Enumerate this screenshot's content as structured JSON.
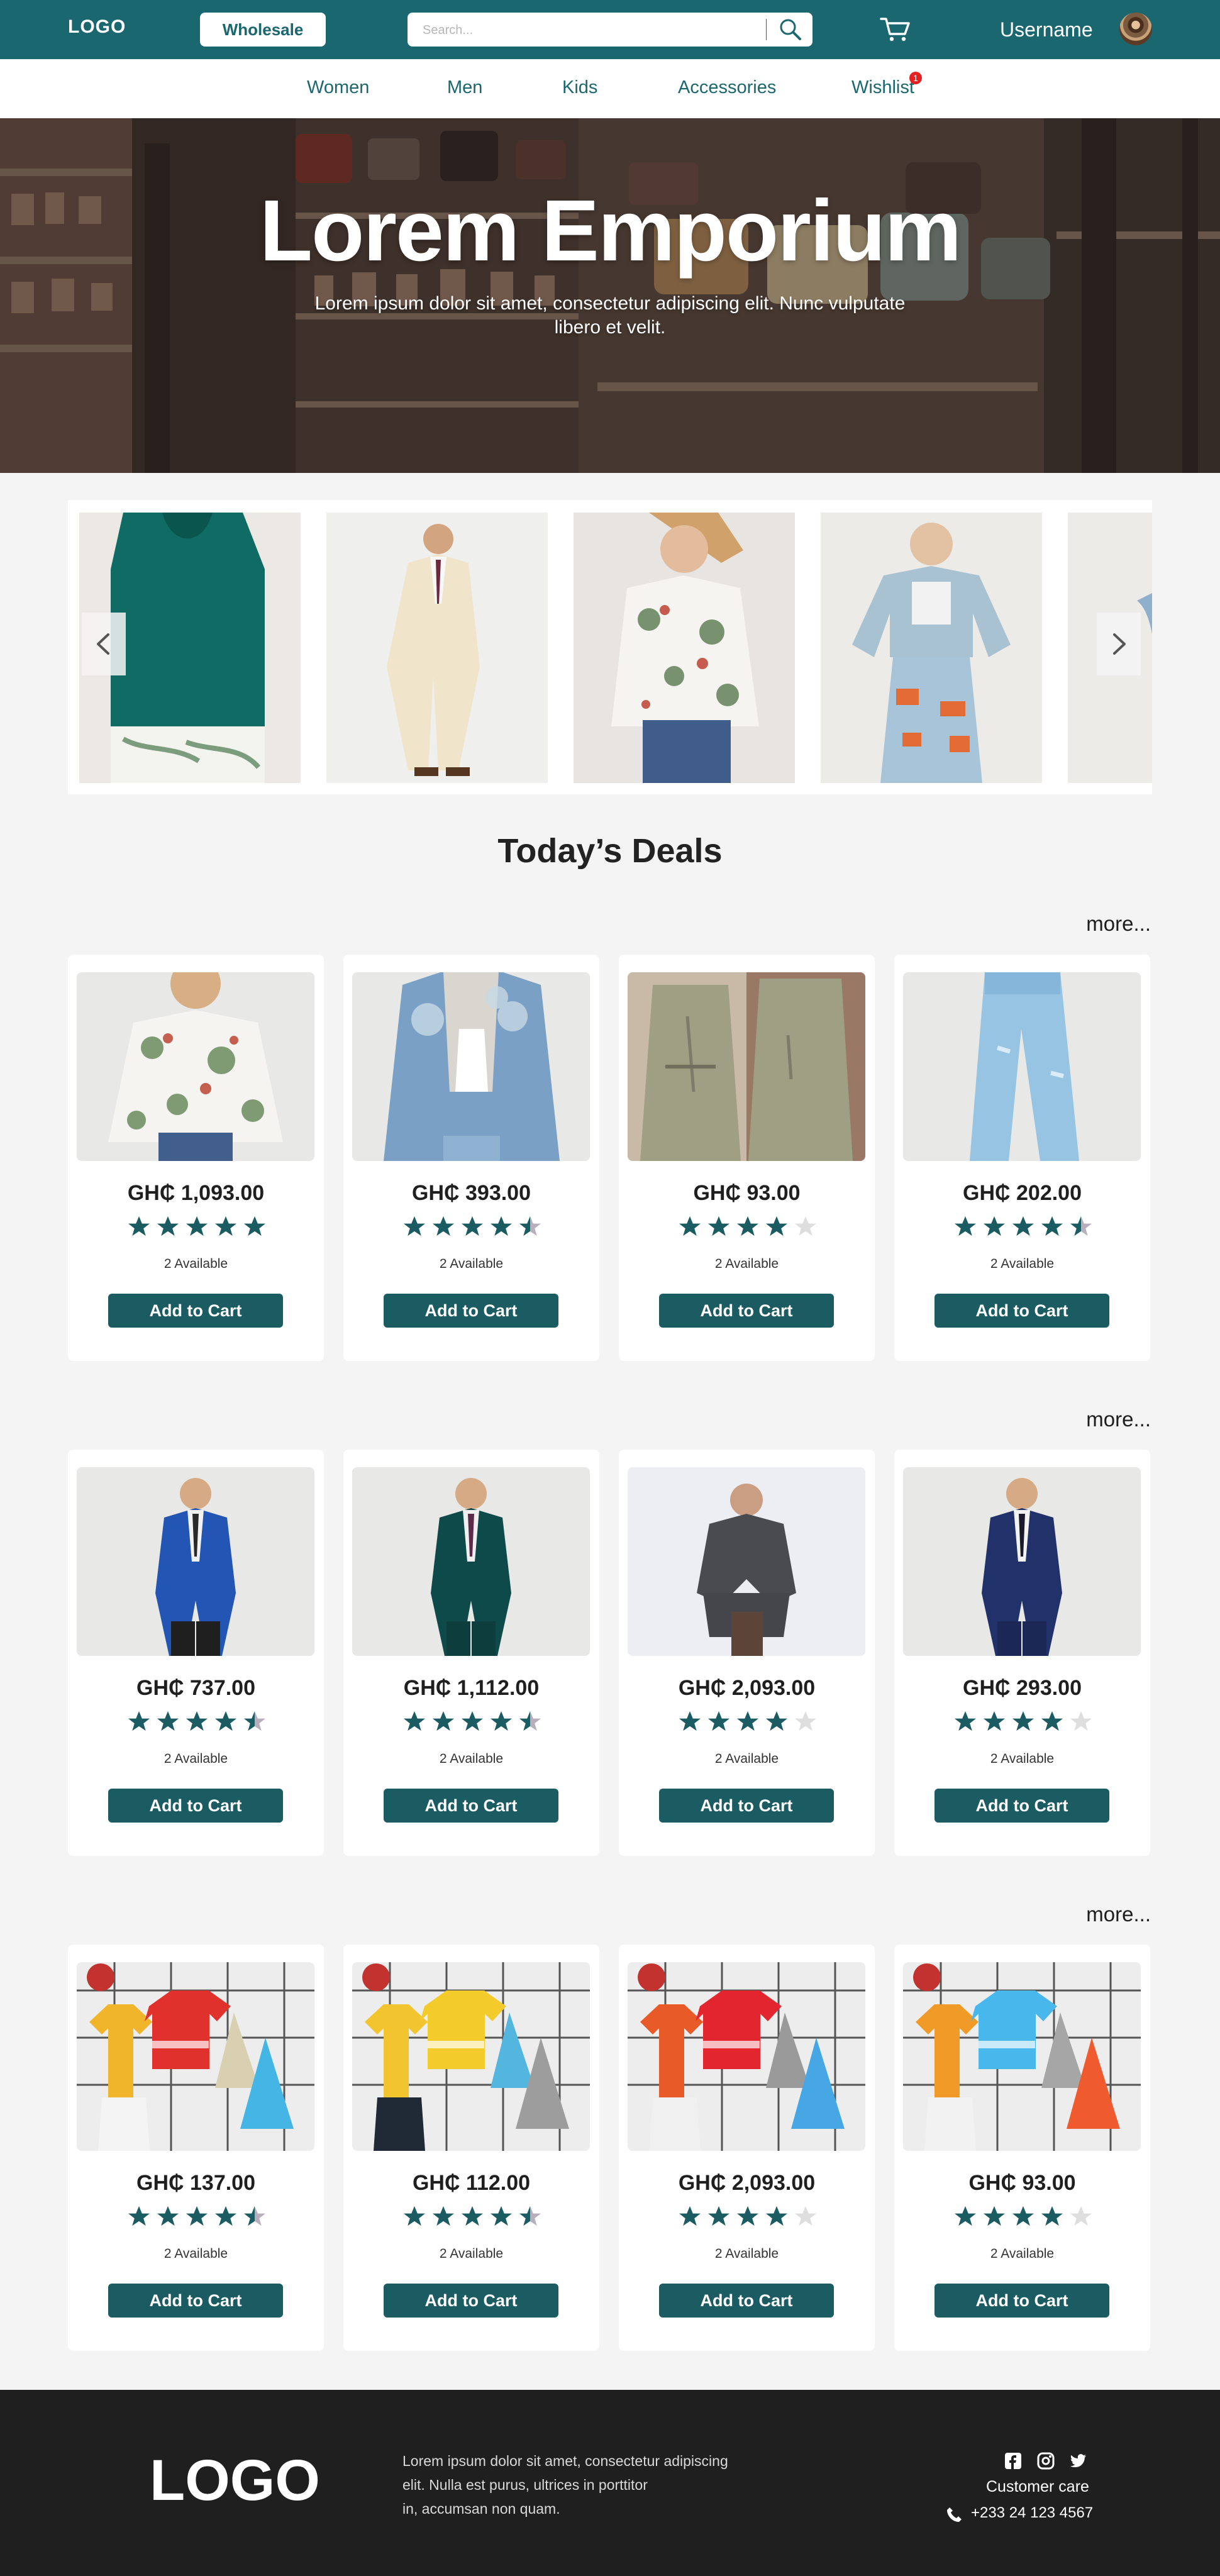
{
  "header": {
    "logo": "LOGO",
    "wholesale_label": "Wholesale",
    "search_placeholder": "Search...",
    "username": "Username"
  },
  "nav": {
    "items": [
      "Women",
      "Men",
      "Kids",
      "Accessories",
      "Wishlist"
    ],
    "wishlist_badge": "1"
  },
  "hero": {
    "title": "Lorem Emporium",
    "subtitle": "Lorem ipsum dolor sit amet, consectetur adipiscing elit. Nunc vulputate libero et velit."
  },
  "carousel": {
    "items": [
      "green-blouse-photo",
      "cream-suit-photo",
      "floral-blouse-photo",
      "denim-jacket-photo",
      "partial-product-photo"
    ]
  },
  "deals": {
    "title": "Today’s Deals",
    "more_label": "more...",
    "rows": [
      [
        {
          "price": "GH₵ 1,093.00",
          "rating": 5,
          "available": "2 Available",
          "button": "Add to Cart",
          "image": "floral-blouse"
        },
        {
          "price": "GH₵ 393.00",
          "rating": 4.5,
          "available": "2 Available",
          "button": "Add to Cart",
          "image": "denim-jacket"
        },
        {
          "price": "GH₵ 93.00",
          "rating": 4,
          "available": "2 Available",
          "button": "Add to Cart",
          "image": "olive-jumpsuit"
        },
        {
          "price": "GH₵ 202.00",
          "rating": 4.5,
          "available": "2 Available",
          "button": "Add to Cart",
          "image": "blue-jeans"
        }
      ],
      [
        {
          "price": "GH₵ 737.00",
          "rating": 4.5,
          "available": "2 Available",
          "button": "Add to Cart",
          "image": "blue-suit"
        },
        {
          "price": "GH₵ 1,112.00",
          "rating": 4.5,
          "available": "2 Available",
          "button": "Add to Cart",
          "image": "green-suit"
        },
        {
          "price": "GH₵ 2,093.00",
          "rating": 4,
          "available": "2 Available",
          "button": "Add to Cart",
          "image": "grey-suit"
        },
        {
          "price": "GH₵ 293.00",
          "rating": 4,
          "available": "2 Available",
          "button": "Add to Cart",
          "image": "navy-suit"
        }
      ],
      [
        {
          "price": "GH₵ 137.00",
          "rating": 4.5,
          "available": "2 Available",
          "button": "Add to Cart",
          "image": "kids-red-set"
        },
        {
          "price": "GH₵ 112.00",
          "rating": 4.5,
          "available": "2 Available",
          "button": "Add to Cart",
          "image": "kids-yellow-set"
        },
        {
          "price": "GH₵ 2,093.00",
          "rating": 4,
          "available": "2 Available",
          "button": "Add to Cart",
          "image": "kids-red-orange-set"
        },
        {
          "price": "GH₵ 93.00",
          "rating": 4,
          "available": "2 Available",
          "button": "Add to Cart",
          "image": "kids-blue-set"
        }
      ]
    ]
  },
  "footer": {
    "logo": "LOGO",
    "text_lines": [
      "Lorem ipsum dolor sit amet, consectetur adipiscing",
      "elit. Nulla est purus, ultrices in porttitor",
      "in, accumsan non quam."
    ],
    "customer_care_label": "Customer care",
    "phone": "+233 24 123 4567"
  },
  "colors": {
    "brand": "#1b6770",
    "button": "#1b5c63",
    "badge": "#e52020",
    "footer": "#1f1f1f"
  }
}
